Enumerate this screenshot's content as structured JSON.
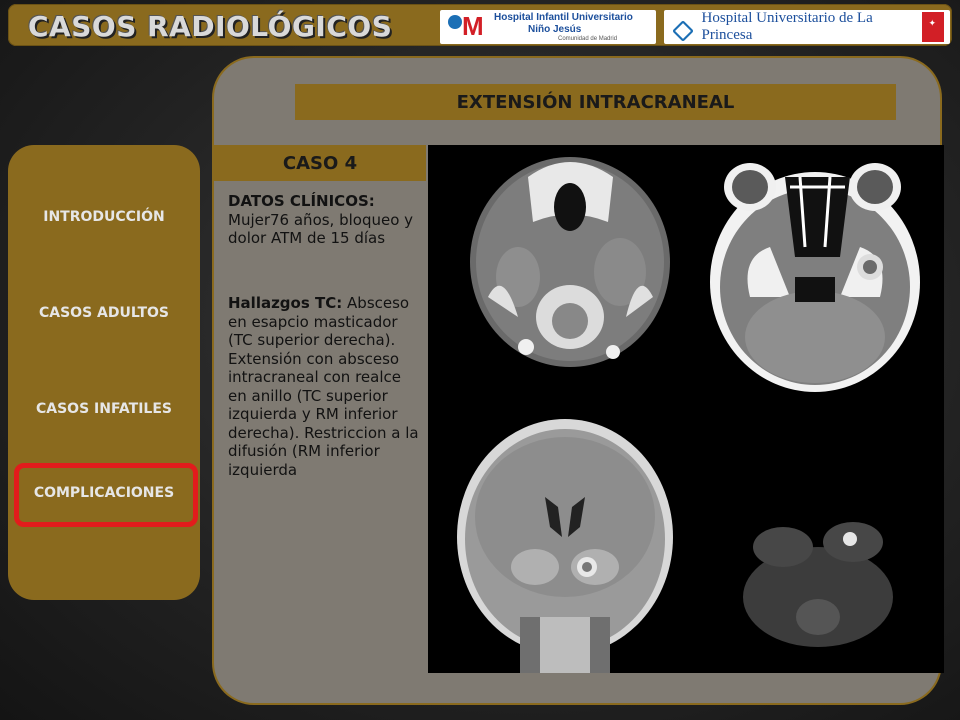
{
  "header": {
    "title": "CASOS RADIOLÓGICOS",
    "logo1_line1": "Hospital Infantil Universitario",
    "logo1_line2": "Niño Jesús",
    "logo1_sub": "Comunidad de Madrid",
    "logo2_text": "Hospital Universitario de La Princesa"
  },
  "sidebar": {
    "items": [
      {
        "label": "INTRODUCCIÓN"
      },
      {
        "label": "CASOS ADULTOS"
      },
      {
        "label": "CASOS INFATILES"
      },
      {
        "label": "COMPLICACIONES",
        "selected": true
      }
    ]
  },
  "main": {
    "section_title": "EXTENSIÓN INTRACRANEAL",
    "case_title": "CASO 4",
    "clinical_label": "DATOS CLÍNICOS:",
    "clinical_text": "Mujer76 años, bloqueo y dolor ATM de 15 días",
    "findings_label": "Hallazgos TC:",
    "findings_text": "Absceso en esapcio masticador (TC superior derecha). Extensión con absceso intracraneal con realce en anillo (TC superior izquierda y RM inferior derecha). Restriccion a la difusión (RM inferior izquierda"
  },
  "colors": {
    "accent": "#8a6a1e",
    "panel": "#7f7a72",
    "highlight": "#e21c1c"
  }
}
